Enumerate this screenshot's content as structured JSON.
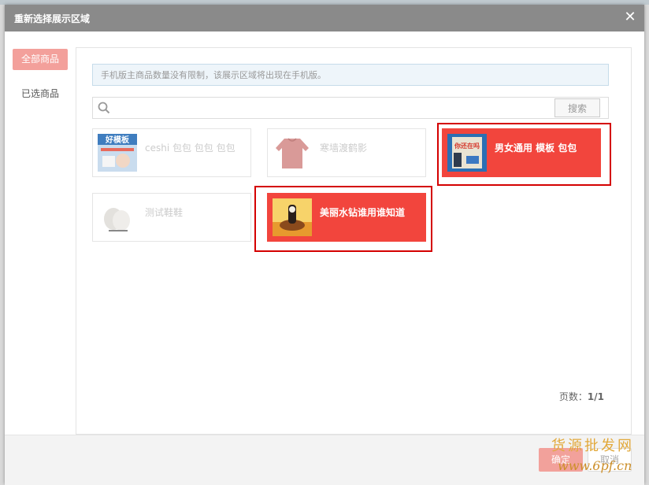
{
  "dialog": {
    "title": "重新选择展示区域",
    "close_symbol": "✕"
  },
  "sidebar": {
    "tabs": [
      {
        "label": "全部商品",
        "active": true
      },
      {
        "label": "已选商品",
        "active": false
      }
    ]
  },
  "notice": "手机版主商品数量没有限制，该展示区域将出现在手机版。",
  "search": {
    "value": "",
    "placeholder": "",
    "button_label": "搜索",
    "icon": "search-icon"
  },
  "products": [
    {
      "name": "ceshi 包包 包包 包包",
      "selected": false,
      "thumb_text": "好模板"
    },
    {
      "name": "寒墙渡鹤影",
      "selected": false
    },
    {
      "name": "男女通用 模板 包包",
      "selected": true,
      "thumb_text": "你还在吗"
    },
    {
      "name": "测试鞋鞋",
      "selected": false
    },
    {
      "name": "美丽水钻谁用谁知道",
      "selected": true
    }
  ],
  "pager": {
    "label": "页数：",
    "value": "1/1"
  },
  "footer": {
    "ok_label": "确定",
    "cancel_label": "取消"
  },
  "watermark": {
    "line1": "货源批发网",
    "line2": "www.6pf.cn"
  },
  "colors": {
    "titlebar": "#8a8a8a",
    "selected_card": "#f2453d",
    "highlight_border": "#d40000",
    "tab_active": "#f3a09b"
  }
}
